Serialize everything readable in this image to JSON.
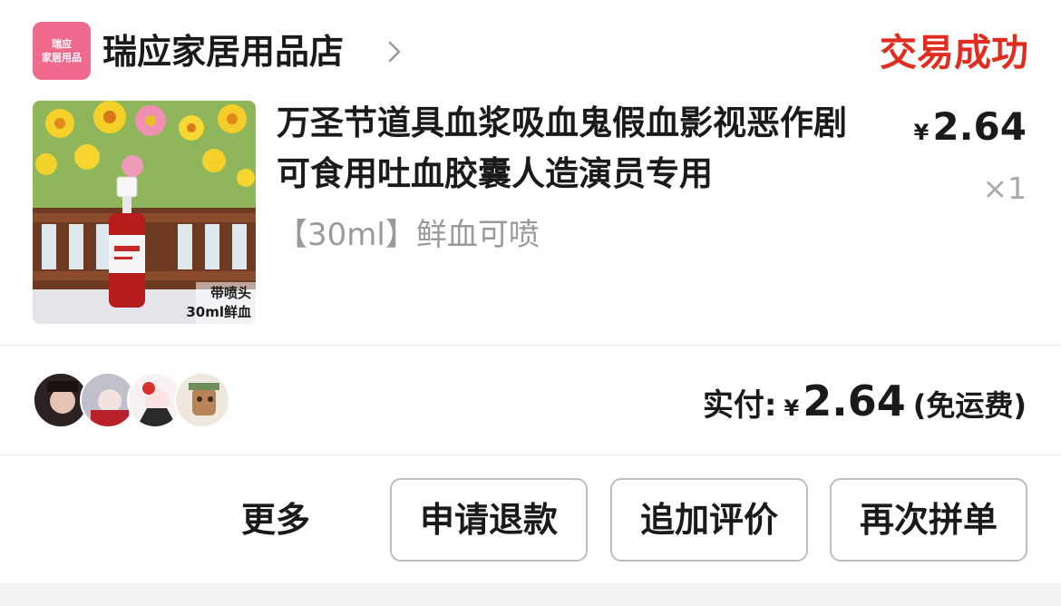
{
  "shop": {
    "logo_line1": "瑞应",
    "logo_line2": "家居用品",
    "name": "瑞应家居用品店",
    "arrow_icon": "chevron-right-icon"
  },
  "order": {
    "status": "交易成功",
    "status_color": "#e02d1f"
  },
  "product": {
    "image_overlay_line1": "带喷头",
    "image_overlay_line2": "30ml鲜血",
    "title": "万圣节道具血浆吸血鬼假血影视恶作剧可食用吐血胶囊人造演员专用",
    "spec": "【30ml】鲜血可喷",
    "currency": "¥",
    "price": "2.64",
    "quantity": "×1"
  },
  "group_avatars": [
    "avatar-1",
    "avatar-2",
    "avatar-3",
    "avatar-4"
  ],
  "payment": {
    "label": "实付:",
    "currency": "¥",
    "amount": "2.64",
    "note": "(免运费)"
  },
  "actions": {
    "more": "更多",
    "refund": "申请退款",
    "review": "追加评价",
    "reorder": "再次拼单"
  }
}
